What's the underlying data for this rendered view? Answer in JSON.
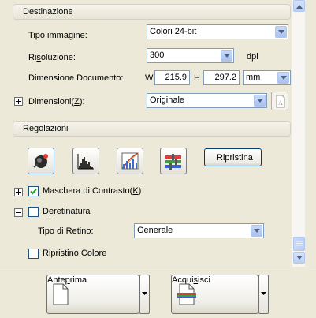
{
  "destinazione": {
    "header": "Destinazione",
    "tipo_immagine": {
      "label_pre": "T",
      "label_u": "i",
      "label_post": "po immagine:",
      "value": "Colori 24-bit"
    },
    "risoluzione": {
      "label_pre": "Ri",
      "label_u": "s",
      "label_post": "oluzione:",
      "value": "300",
      "unit": "dpi"
    },
    "dimensione_documento": {
      "label": "Dimensione Documento:",
      "w_label": "W",
      "w_value": "215.9",
      "h_label": "H",
      "h_value": "297.2",
      "unit_value": "mm"
    },
    "dimensioni": {
      "label_pre": "Dimensioni(",
      "label_u": "Z",
      "label_post": "):",
      "value": "Originale"
    }
  },
  "regolazioni": {
    "header": "Regolazioni",
    "tools": [
      {
        "name": "auto-exposure-icon"
      },
      {
        "name": "histogram-icon"
      },
      {
        "name": "tone-curve-icon"
      },
      {
        "name": "color-palette-icon"
      }
    ],
    "reset_label": "Ripristina",
    "maschera": {
      "label_pre": "Maschera di Contrasto(",
      "label_u": "K",
      "label_post": ")",
      "checked": true
    },
    "deretinatura": {
      "label_pre": "D",
      "label_u": "e",
      "label_post": "retinatura",
      "checked": false
    },
    "tipo_retino": {
      "label": "Tipo di Retino:",
      "value": "Generale"
    },
    "ripristino_colore": {
      "label": "Ripristino Colore",
      "checked": false
    }
  },
  "actions": {
    "preview": {
      "label_pre": "Ante",
      "label_u": "p",
      "label_post": "rima"
    },
    "scan": {
      "label_pre": "Acqui",
      "label_u": "s",
      "label_post": "isci"
    }
  },
  "colors": {
    "accent_border": "#7f9db9",
    "button_border": "#003c74",
    "check": "#21a121"
  }
}
